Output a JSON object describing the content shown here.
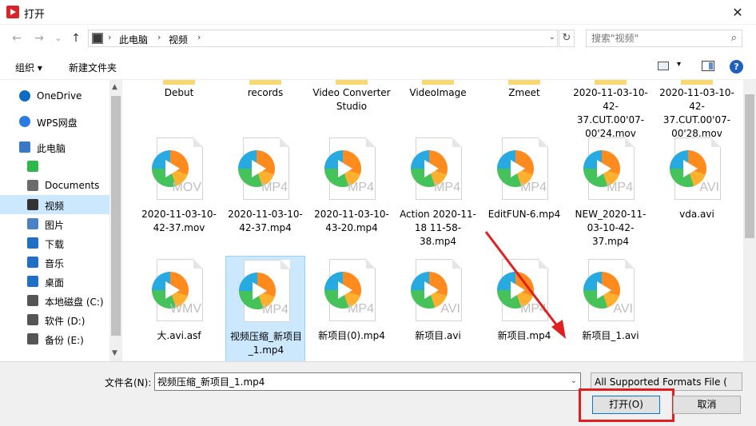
{
  "window": {
    "title": "打开",
    "close": "✕"
  },
  "nav": {
    "back": "←",
    "forward": "→",
    "recent": "⌄",
    "up": "↑",
    "crumbs": [
      "此电脑",
      "视频"
    ],
    "refresh": "↻",
    "search_placeholder": "搜索\"视频\"",
    "search_icon": "⌕"
  },
  "toolbar": {
    "organize": "组织 ▾",
    "new_folder": "新建文件夹",
    "help": "?"
  },
  "sidebar": {
    "items": [
      {
        "label": "OneDrive",
        "icon": "cloud-icon",
        "color": "#0f6cc4"
      },
      {
        "label": "WPS网盘",
        "icon": "cloud-icon",
        "color": "#2a7be4"
      },
      {
        "label": "此电脑",
        "icon": "computer-icon",
        "color": "#3b79c7"
      },
      {
        "label": "",
        "icon": "green-app-icon",
        "color": "#30b84a"
      },
      {
        "label": "Documents",
        "icon": "document-icon",
        "color": "#6b6b6b"
      },
      {
        "label": "视频",
        "icon": "film-icon",
        "color": "#333333",
        "selected": true
      },
      {
        "label": "图片",
        "icon": "picture-icon",
        "color": "#4a83c5"
      },
      {
        "label": "下载",
        "icon": "download-icon",
        "color": "#1f6fc5"
      },
      {
        "label": "音乐",
        "icon": "music-icon",
        "color": "#1f6fc5"
      },
      {
        "label": "桌面",
        "icon": "desktop-icon",
        "color": "#1f6fc5"
      },
      {
        "label": "本地磁盘 (C:)",
        "icon": "drive-icon",
        "color": "#555555"
      },
      {
        "label": "软件 (D:)",
        "icon": "drive-icon",
        "color": "#555555"
      },
      {
        "label": "备份 (E:)",
        "icon": "drive-icon",
        "color": "#555555"
      }
    ]
  },
  "files": {
    "row1": [
      {
        "name": "Debut"
      },
      {
        "name": "records"
      },
      {
        "name": "Video Converter Studio"
      },
      {
        "name": "VideoImage"
      },
      {
        "name": "Zmeet"
      },
      {
        "name": "2020-11-03-10-42-37.CUT.00'07-00'24.mov"
      },
      {
        "name": "2020-11-03-10-42-37.CUT.00'07-00'28.mov"
      }
    ],
    "row2": [
      {
        "name": "2020-11-03-10-42-37.mov",
        "ext": "MOV"
      },
      {
        "name": "2020-11-03-10-42-37.mp4",
        "ext": "MP4"
      },
      {
        "name": "2020-11-03-10-43-20.mp4",
        "ext": "MP4"
      },
      {
        "name": "Action 2020-11-18 11-58-38.mp4",
        "ext": "MP4"
      },
      {
        "name": "EditFUN-6.mp4",
        "ext": "MP4"
      },
      {
        "name": "NEW_2020-11-03-10-42-37.mp4",
        "ext": "MP4"
      },
      {
        "name": "vda.avi",
        "ext": "AVI"
      }
    ],
    "row3": [
      {
        "name": "大.avi.asf",
        "ext": "WMV"
      },
      {
        "name": "视频压缩_新项目_1.mp4",
        "ext": "MP4",
        "selected": true
      },
      {
        "name": "新项目(0).mp4",
        "ext": "MP4"
      },
      {
        "name": "新项目.avi",
        "ext": "AVI"
      },
      {
        "name": "新项目.mp4",
        "ext": "MP4"
      },
      {
        "name": "新项目_1.avi",
        "ext": "AVI"
      }
    ]
  },
  "bottom": {
    "filename_label": "文件名(N):",
    "filename_value": "视频压缩_新项目_1.mp4",
    "filter": "All Supported Formats File (",
    "open": "打开(O)",
    "cancel": "取消"
  },
  "colors": {
    "accent": "#0078d7",
    "selection": "#cce8ff",
    "annotation": "#e02020"
  }
}
